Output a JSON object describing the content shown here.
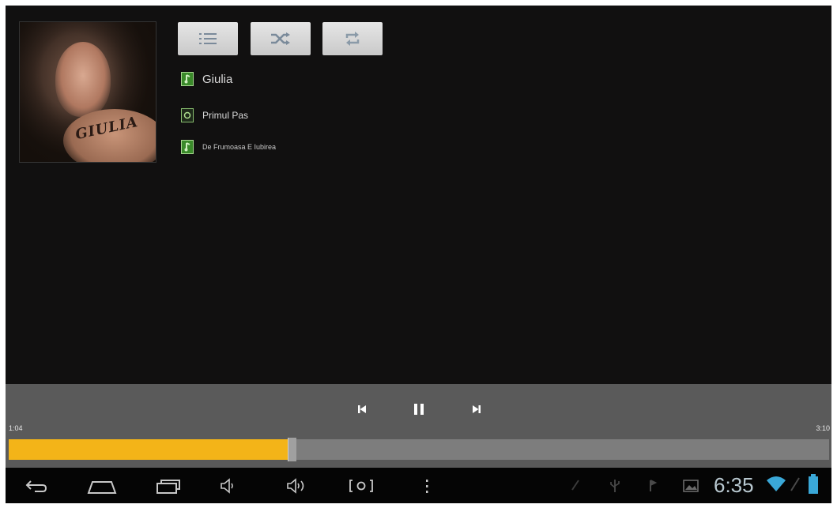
{
  "album": {
    "art_text": "GIULIA"
  },
  "top_buttons": {
    "list_icon": "playlist-icon",
    "shuffle_icon": "shuffle-icon",
    "repeat_icon": "repeat-icon"
  },
  "tracks": [
    {
      "title": "Giulia"
    },
    {
      "title": "Primul Pas"
    },
    {
      "title": "De Frumoasa E Iubirea"
    }
  ],
  "player": {
    "time_elapsed": "1:04",
    "time_total": "3:10",
    "progress": 0.34,
    "accent_color": "#f3b418",
    "prev_icon": "skip-previous-icon",
    "pause_icon": "pause-icon",
    "next_icon": "skip-next-icon"
  },
  "system_bar": {
    "clock": "6:35",
    "nav_icons": [
      "back-icon",
      "home-icon",
      "recent-apps-icon",
      "volume-down-icon",
      "volume-up-icon",
      "screenshot-icon",
      "menu-icon"
    ],
    "status_icons": [
      "notification-icon",
      "usb-icon",
      "debug-icon",
      "gallery-icon",
      "wifi-icon",
      "battery-icon"
    ]
  }
}
